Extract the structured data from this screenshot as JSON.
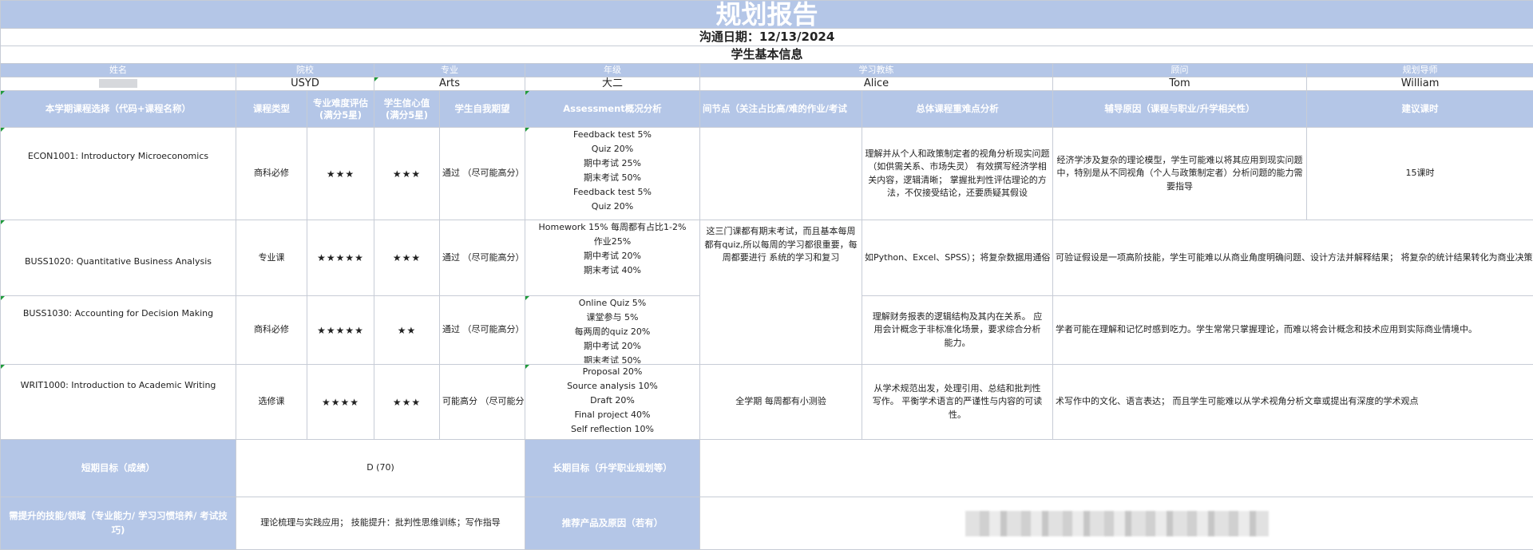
{
  "title": "规划报告",
  "comm_date": "沟通日期：12/13/2024",
  "section_basic": "学生基本信息",
  "basic": {
    "headers": [
      "姓名",
      "院校",
      "专业",
      "年级",
      "学习教练",
      "顾问",
      "规划导师"
    ],
    "values": [
      "",
      "USYD",
      "Arts",
      "大二",
      "Alice",
      "Tom",
      "William"
    ]
  },
  "course_headers": [
    "本学期课程选择（代码+课程名称）",
    "课程类型",
    "专业难度评估\n(满分5星)",
    "学生信心值\n(满分5星)",
    "学生自我期望",
    "Assessment概况分析",
    "间节点（关注占比高/难的作业/考试",
    "总体课程重难点分析",
    "辅导原因（课程与职业/升学相关性）",
    "建议课时"
  ],
  "courses": [
    {
      "name": "ECON1001: Introductory Microeconomics",
      "type": "商科必修",
      "difficulty": "★★★",
      "confidence": "★★★",
      "expectation": "通过 （尽可能高分）",
      "assessment": [
        "Feedback test 5%",
        "Quiz 20%",
        "期中考试 25%",
        "期末考试 50%",
        "Feedback test 5%",
        "Quiz 20%"
      ],
      "analysis": "理解并从个人和政策制定者的视角分析现实问题（如供需关系、市场失灵） 有效撰写经济学相关内容，逻辑清晰；  掌握批判性评估理论的方法，不仅接受结论，还要质疑其假设",
      "reason": "经济学涉及复杂的理论模型，学生可能难以将其应用到现实问题中，特别是从不同视角（个人与政策制定者）分析问题的能力需要指导",
      "hours": "15课时"
    },
    {
      "name": "BUSS1020: Quantitative Business Analysis",
      "type": "专业课",
      "difficulty": "★★★★★",
      "confidence": "★★★",
      "expectation": "通过 （尽可能高分）",
      "assessment": [
        "Homework 15% 每周都有占比1-2%",
        "作业25%",
        "期中考试 20%",
        "期末考试 40%"
      ],
      "analysis": "如Python、Excel、SPSS）；将复杂数据用通俗",
      "reason": "可验证假设是一项高阶技能，学生可能难以从商业角度明确问题、设计方法并解释结果；  将复杂的统计结果转化为商业决策所需的",
      "hours": ""
    },
    {
      "name": "BUSS1030: Accounting for Decision Making",
      "type": "商科必修",
      "difficulty": "★★★★★",
      "confidence": "★★",
      "expectation": "通过 （尽可能高分）",
      "assessment": [
        "Online Quiz 5%",
        "课堂参与 5%",
        "每两周的quiz 20%",
        "期中考试 20%",
        "期末考试 50%"
      ],
      "analysis": "理解财务报表的逻辑结构及其内在关系。 应用会计概念于非标准化场景，要求综合分析能力。",
      "reason": "学者可能在理解和记忆时感到吃力。学生常常只掌握理论，而难以将会计概念和技术应用到实际商业情境中。",
      "hours": ""
    },
    {
      "name": "WRIT1000: Introduction to Academic Writing",
      "type": "选修课",
      "difficulty": "★★★★",
      "confidence": "★★★",
      "expectation": "可能高分 （尽可能分",
      "assessment": [
        "Proposal 20%",
        "Source analysis 10%",
        "Draft 20%",
        "Final project 40%",
        "Self reflection 10%"
      ],
      "analysis": "从学术规范出发，处理引用、总结和批判性写作。 平衡学术语言的严谨性与内容的可读性。",
      "reason": "术写作中的文化、语言表达；  而且学生可能难以从学术视角分析文章或提出有深度的学术观点",
      "hours": ""
    }
  ],
  "merged_timeline_1": "这三门课都有期末考试，而且基本每周都有quiz,所以每周的学习都很重要，每周都要进行 系统的学习和复习",
  "merged_timeline_2": "全学期 每周都有小测验",
  "goals": {
    "short_label": "短期目标（成绩）",
    "short_value": "D (70)",
    "long_label": "长期目标（升学职业规划等）",
    "long_value": "",
    "skills_label": "需提升的技能/领域（专业能力/ 学习习惯培养/ 考试技巧)",
    "skills_value": "理论梳理与实践应用；  技能提升：批判性思维训练；写作指导",
    "product_label": "推荐产品及原因（若有）"
  }
}
